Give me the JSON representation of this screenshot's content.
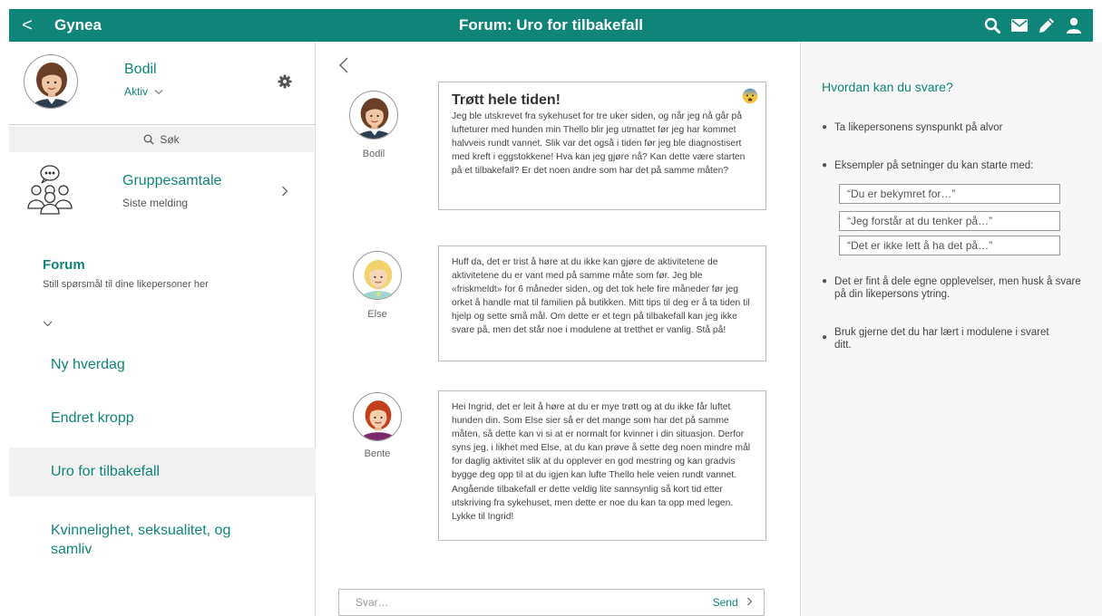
{
  "topbar": {
    "back_label": "<",
    "app_name": "Gynea",
    "title": "Forum: Uro for tilbakefall",
    "icons": [
      "search-icon",
      "mail-icon",
      "pencil-icon",
      "user-icon"
    ]
  },
  "profile": {
    "name": "Bodil",
    "status": "Aktiv",
    "settings_icon": "gear-icon"
  },
  "sidebar": {
    "search_label": "Søk",
    "group": {
      "title": "Gruppesamtale",
      "subtitle": "Siste melding"
    },
    "forum": {
      "title": "Forum",
      "subtitle": "Still spørsmål til dine likepersoner her"
    },
    "items": [
      {
        "label": "Ny hverdag"
      },
      {
        "label": "Endret kropp"
      },
      {
        "label": "Uro for tilbakefall"
      },
      {
        "label": "Kvinnelighet, seksualitet, og samliv"
      }
    ]
  },
  "posts": [
    {
      "author": "Bodil",
      "title": "Trøtt hele tiden!",
      "emoji": "anxious-face-emoji",
      "body": "Jeg ble utskrevet fra sykehuset for tre uker siden, og når jeg nå går på lufteturer med hunden min Thello blir jeg utmattet før jeg har kommet halvveis rundt vannet. Slik var det også i tiden før jeg ble diagnostisert med kreft i eggstokkene! Hva kan jeg gjøre nå? Kan dette være starten på et tilbakefall? Er det noen andre som har det på samme måten?"
    },
    {
      "author": "Else",
      "body": "Huff da, det er trist å høre at du ikke kan gjøre de aktivitetene de aktivitetene du er vant med på samme måte som før. Jeg ble «friskmeldt» for 6 måneder siden, og det tok hele fire måneder før jeg orket å handle mat til familien på butikken. Mitt tips til deg er å ta tiden til hjelp og sette små mål. Om dette er et tegn på tilbakefall kan jeg ikke svare på, men det står noe i modulene at tretthet er vanlig. Stå på!"
    },
    {
      "author": "Bente",
      "body": "Hei Ingrid, det er leit å høre at du er mye trøtt og at du ikke får luftet hunden din. Som Else sier så er det mange som har det på samme måten, så dette kan vi si at er normalt for kvinner i din situasjon. Derfor syns jeg, i likhet med Else, at du kan prøve å sette deg noen mindre mål for daglig aktivitet slik at du opplever en god mestring og kan gradvis bygge deg opp til at du igjen kan lufte Thello hele veien rundt vannet. Angående tilbakefall er dette veldig lite sannsynlig så kort tid etter utskriving fra sykehuset, men dette er noe du kan ta opp med legen. Lykke til Ingrid!"
    }
  ],
  "reply": {
    "placeholder": "Svar…",
    "send_label": "Send"
  },
  "help": {
    "title": "Hvordan kan du svare?",
    "tips": [
      "Ta likepersonens synspunkt på alvor",
      "Eksempler på setninger du kan starte med:",
      "Det er fint å dele egne opplevelser, men husk å svare på din likepersons ytring.",
      "Bruk gjerne det du har lært i modulene i svaret ditt."
    ],
    "examples": [
      "“Du er bekymret for…”",
      "“Jeg forstår at du tenker på…”",
      "“Det er ikke lett å ha det på…”"
    ]
  },
  "colors": {
    "brand": "#0f8578",
    "active_item_bg": "#f2f2f2",
    "help_panel_bg": "#f7f7f7"
  }
}
